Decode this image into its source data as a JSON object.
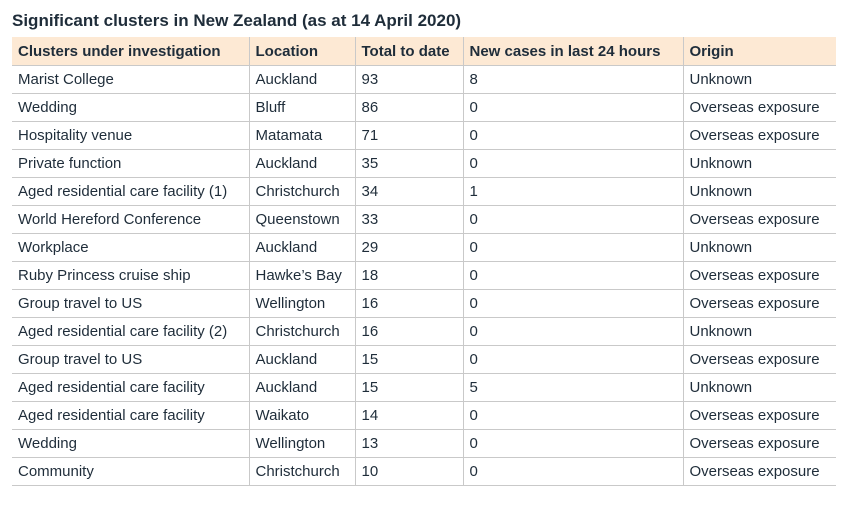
{
  "title": "Significant clusters in New Zealand (as at 14 April 2020)",
  "headers": [
    "Clusters under investigation",
    "Location",
    "Total to date",
    "New cases in last 24 hours",
    "Origin"
  ],
  "rows": [
    [
      "Marist College",
      "Auckland",
      "93",
      "8",
      "Unknown"
    ],
    [
      "Wedding",
      "Bluff",
      "86",
      "0",
      "Overseas exposure"
    ],
    [
      "Hospitality venue",
      "Matamata",
      "71",
      "0",
      "Overseas exposure"
    ],
    [
      "Private function",
      "Auckland",
      "35",
      "0",
      "Unknown"
    ],
    [
      "Aged residential care facility (1)",
      "Christchurch",
      "34",
      "1",
      "Unknown"
    ],
    [
      "World Hereford Conference",
      "Queenstown",
      "33",
      "0",
      "Overseas exposure"
    ],
    [
      "Workplace",
      "Auckland",
      "29",
      "0",
      "Unknown"
    ],
    [
      "Ruby Princess cruise ship",
      "Hawke’s Bay",
      "18",
      "0",
      "Overseas exposure"
    ],
    [
      "Group travel to US",
      "Wellington",
      "16",
      "0",
      "Overseas exposure"
    ],
    [
      "Aged residential care facility (2)",
      "Christchurch",
      "16",
      "0",
      "Unknown"
    ],
    [
      "Group travel to US",
      "Auckland",
      "15",
      "0",
      "Overseas exposure"
    ],
    [
      "Aged residential care facility",
      "Auckland",
      "15",
      "5",
      "Unknown"
    ],
    [
      "Aged residential care facility",
      "Waikato",
      "14",
      "0",
      "Overseas exposure"
    ],
    [
      "Wedding",
      "Wellington",
      "13",
      "0",
      "Overseas exposure"
    ],
    [
      "Community",
      "Christchurch",
      "10",
      "0",
      "Overseas exposure"
    ]
  ]
}
